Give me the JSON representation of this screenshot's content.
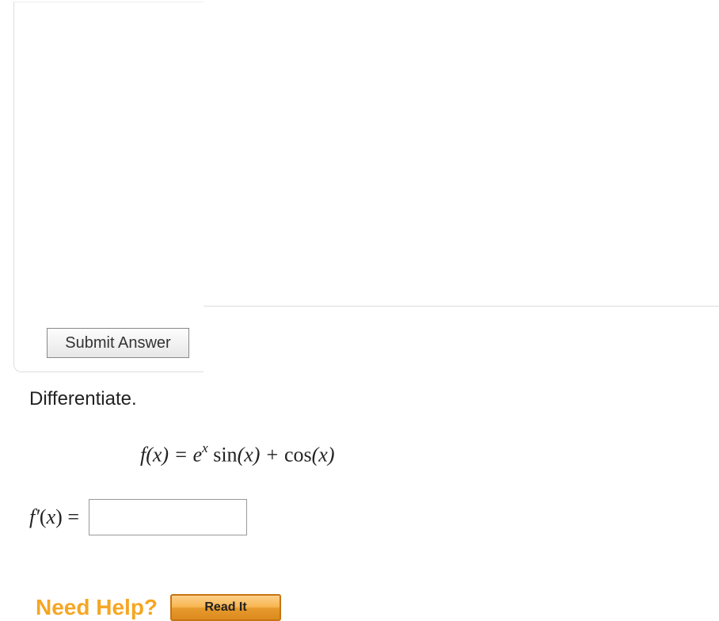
{
  "instruction": "Differentiate.",
  "equation": {
    "lhs": "f(x) = ",
    "base": "e",
    "exp": "x",
    "rest1": " ",
    "sin": "sin",
    "mid": "(x) + ",
    "cos": "cos",
    "rest2": "(x)"
  },
  "answer": {
    "label_f": "f",
    "label_prime": "′",
    "label_paren1": "(",
    "label_x": "x",
    "label_paren2": ") ",
    "label_eq": "=",
    "value": ""
  },
  "help": {
    "label": "Need Help?",
    "read_label": "Read It"
  },
  "submit": {
    "label": "Submit Answer"
  }
}
